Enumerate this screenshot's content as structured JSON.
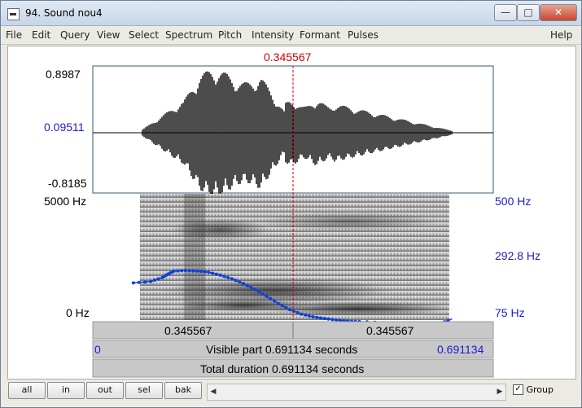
{
  "window": {
    "title": "94. Sound nou4",
    "minimize": "—",
    "maximize": "□",
    "close": "✕"
  },
  "menu": {
    "items": [
      "File",
      "Edit",
      "Query",
      "View",
      "Select",
      "Spectrum",
      "Pitch",
      "Intensity",
      "Formant",
      "Pulses"
    ],
    "help": "Help"
  },
  "cursor": {
    "time_label": "0.345567",
    "fraction": 0.5
  },
  "waveform": {
    "top_label": "0.8987",
    "mid_label": "0.09511",
    "bottom_label": "-0.8185"
  },
  "spectrogram": {
    "freq_top": "5000 Hz",
    "freq_bottom": "0 Hz",
    "pitch_top": "500 Hz",
    "pitch_mid": "292.8 Hz",
    "pitch_bottom": "75 Hz"
  },
  "pitch_track": {
    "times": [
      0.07,
      0.1,
      0.12,
      0.13,
      0.14,
      0.16,
      0.18,
      0.2,
      0.22,
      0.24,
      0.26,
      0.28,
      0.3,
      0.32,
      0.34,
      0.36,
      0.38,
      0.4,
      0.42,
      0.44,
      0.46,
      0.5,
      0.54,
      0.58,
      0.6,
      0.62
    ],
    "hz": [
      200,
      205,
      218,
      230,
      240,
      242,
      240,
      236,
      226,
      214,
      198,
      178,
      155,
      131,
      110,
      95,
      86,
      80,
      75,
      72,
      70,
      66,
      62,
      61,
      64,
      79
    ]
  },
  "time_rows": {
    "left_half": "0.345567",
    "right_half": "0.345567",
    "visible_start": "0",
    "visible_text": "Visible part 0.691134 seconds",
    "visible_end": "0.691134",
    "total_text": "Total duration 0.691134 seconds"
  },
  "bottom": {
    "all": "all",
    "in": "in",
    "out": "out",
    "sel": "sel",
    "bak": "bak",
    "scroll_left": "◀",
    "scroll_right": "▶",
    "group_label": "Group",
    "group_check": "✓"
  },
  "colors": {
    "pitch": "#1040d8",
    "cursor": "#d00000",
    "label_blue": "#1c1cd0"
  }
}
